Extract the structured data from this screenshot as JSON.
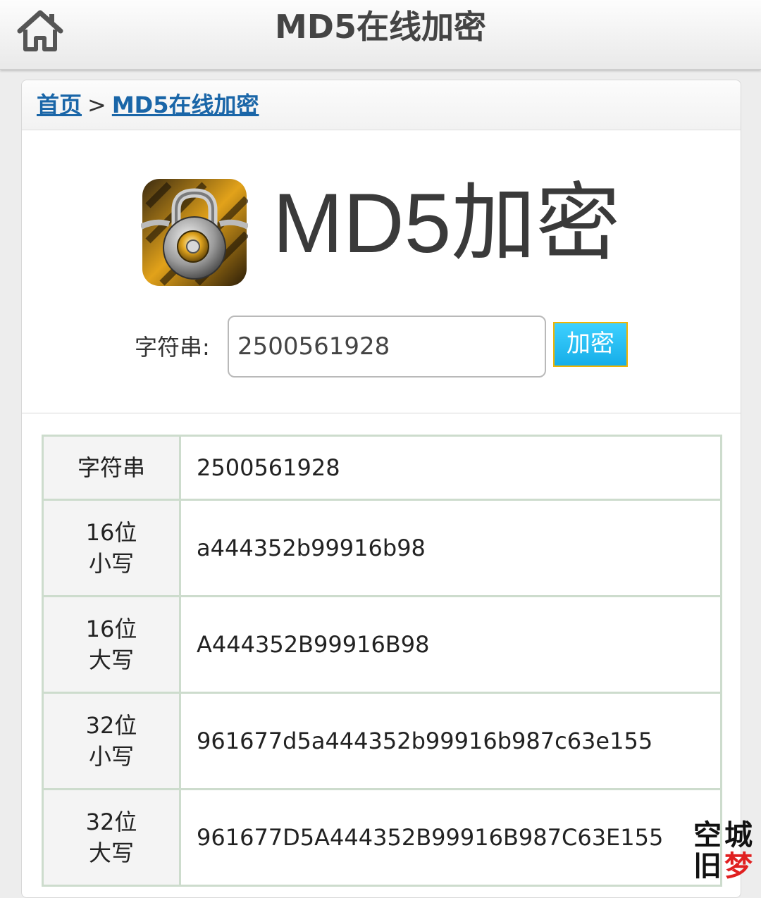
{
  "topbar": {
    "home_icon": "home-icon",
    "title": "MD5在线加密"
  },
  "breadcrumb": {
    "home_label": "首页",
    "separator": ">",
    "current_label": "MD5在线加密"
  },
  "hero": {
    "icon": "padlock-icon",
    "title": "MD5加密"
  },
  "form": {
    "label": "字符串:",
    "input_value": "2500561928",
    "button_label": "加密",
    "button_color": "#16aee8",
    "button_border": "#f2b400"
  },
  "results": [
    {
      "key_line1": "字符串",
      "key_line2": "",
      "value": "2500561928"
    },
    {
      "key_line1": "16位",
      "key_line2": "小写",
      "value": "a444352b99916b98"
    },
    {
      "key_line1": "16位",
      "key_line2": "大写",
      "value": "A444352B99916B98"
    },
    {
      "key_line1": "32位",
      "key_line2": "小写",
      "value": "961677d5a444352b99916b987c63e155"
    },
    {
      "key_line1": "32位",
      "key_line2": "大写",
      "value": "961677D5A444352B99916B987C63E155"
    }
  ],
  "watermark": {
    "chars": [
      "空",
      "城",
      "旧",
      "梦"
    ],
    "colors": [
      "#111111",
      "#111111",
      "#111111",
      "#e02020"
    ]
  }
}
